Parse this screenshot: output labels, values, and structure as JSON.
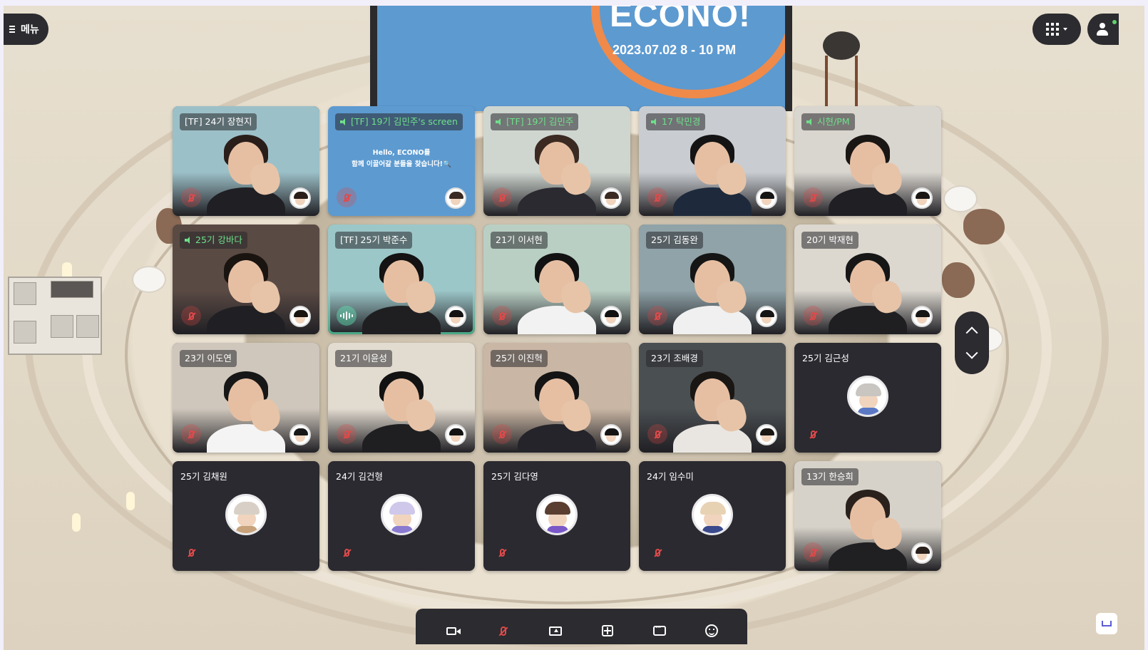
{
  "menu": {
    "label": "메뉴"
  },
  "presentation": {
    "headline": "ECONO!",
    "date": "2023.07.02 8 - 10 PM"
  },
  "tiles": [
    {
      "name": "[TF] 24기 장현지",
      "speaking": false,
      "kind": "video",
      "bg": "#9cc0c8",
      "shirt": "#1f1f24",
      "hair": "#2a1e1a"
    },
    {
      "name": "[TF] 19기 김민주's screen",
      "speaking": true,
      "kind": "screen",
      "content": "Hello, ECONO를\n함께 이끌어갈 분들을 찾습니다!🔍"
    },
    {
      "name": "[TF] 19기 김민주",
      "speaking": true,
      "kind": "video",
      "bg": "#cfd6d0",
      "shirt": "#2a2a30",
      "hair": "#3a2a22"
    },
    {
      "name": "17 탁민경",
      "speaking": true,
      "kind": "video",
      "bg": "#c9cdd1",
      "shirt": "#1e2a3c",
      "hair": "#141414"
    },
    {
      "name": "시현/PM",
      "speaking": true,
      "kind": "video",
      "bg": "#d9d5cf",
      "shirt": "#1f1f24",
      "hair": "#1a1614"
    },
    {
      "name": "25기 강바다",
      "speaking": true,
      "kind": "video",
      "bg": "#5a4a44",
      "shirt": "#202024",
      "hair": "#1a1410"
    },
    {
      "name": "[TF] 25기 박준수",
      "speaking": false,
      "kind": "video",
      "active": true,
      "bg": "#9cc7c9",
      "shirt": "#1f1f22",
      "hair": "#141212"
    },
    {
      "name": "21기 이서현",
      "speaking": false,
      "kind": "video",
      "bg": "#b9cfc4",
      "shirt": "#f2f2f2",
      "hair": "#121212"
    },
    {
      "name": "25기 김동완",
      "speaking": false,
      "kind": "video",
      "bg": "#8fa3a8",
      "shirt": "#f0f0f0",
      "hair": "#151515"
    },
    {
      "name": "20기 박재현",
      "speaking": false,
      "kind": "video",
      "bg": "#dcd8d0",
      "shirt": "#1f1f22",
      "hair": "#161616"
    },
    {
      "name": "23기 이도연",
      "speaking": false,
      "kind": "video",
      "bg": "#cfc7bc",
      "shirt": "#f4f4f4",
      "hair": "#171717"
    },
    {
      "name": "21기 이윤성",
      "speaking": false,
      "kind": "video",
      "bg": "#e2dbd0",
      "shirt": "#1f1f22",
      "hair": "#121212"
    },
    {
      "name": "25기 이진혁",
      "speaking": false,
      "kind": "video",
      "bg": "#c9b6a4",
      "shirt": "#24242a",
      "hair": "#141414"
    },
    {
      "name": "23기 조배경",
      "speaking": false,
      "kind": "video",
      "bg": "#4a4f52",
      "shirt": "#e9e6e1",
      "hair": "#1a1614"
    },
    {
      "name": "25기 김근성",
      "speaking": false,
      "kind": "avatar",
      "hair": "#c9c6c2",
      "shirt": "#5b78c4"
    },
    {
      "name": "25기 김채원",
      "speaking": false,
      "kind": "avatar",
      "hair": "#d8d0c6",
      "shirt": "#c7a27b"
    },
    {
      "name": "24기 김건형",
      "speaking": false,
      "kind": "avatar",
      "hair": "#cfc8ea",
      "shirt": "#8a7ad0"
    },
    {
      "name": "25기 김다영",
      "speaking": false,
      "kind": "avatar",
      "hair": "#5a3e30",
      "shirt": "#7a58c8"
    },
    {
      "name": "24기 임수미",
      "speaking": false,
      "kind": "avatar",
      "hair": "#e8d2b4",
      "shirt": "#3a4a8c"
    },
    {
      "name": "13기 한승희",
      "speaking": false,
      "kind": "video",
      "bg": "#d7d2c9",
      "shirt": "#202022",
      "hair": "#2a201c"
    }
  ],
  "icons": {
    "menu": "hamburger-icon",
    "grid": "grid-view-icon",
    "profile": "person-icon",
    "scroll_up": "chevron-up-icon",
    "scroll_down": "chevron-down-icon"
  },
  "toolbar": [
    "camera-icon",
    "mic-muted-icon",
    "screen-share-icon",
    "add-object-icon",
    "chat-icon",
    "emoji-icon"
  ],
  "colors": {
    "speaking": "#6fe08a",
    "active_border": "#5fe0b1",
    "muted": "#e04a4a",
    "toolbar_bg": "#2b2b30"
  }
}
